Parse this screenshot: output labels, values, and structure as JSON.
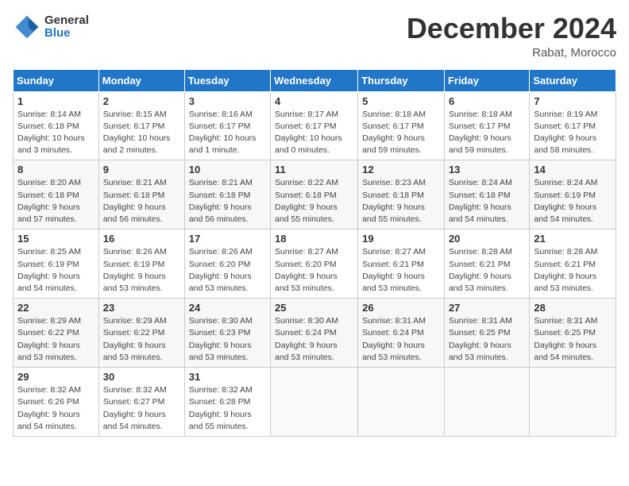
{
  "logo": {
    "general": "General",
    "blue": "Blue"
  },
  "title": "December 2024",
  "location": "Rabat, Morocco",
  "days_of_week": [
    "Sunday",
    "Monday",
    "Tuesday",
    "Wednesday",
    "Thursday",
    "Friday",
    "Saturday"
  ],
  "weeks": [
    [
      {
        "day": "1",
        "sunrise": "8:14 AM",
        "sunset": "6:18 PM",
        "daylight": "10 hours and 3 minutes."
      },
      {
        "day": "2",
        "sunrise": "8:15 AM",
        "sunset": "6:17 PM",
        "daylight": "10 hours and 2 minutes."
      },
      {
        "day": "3",
        "sunrise": "8:16 AM",
        "sunset": "6:17 PM",
        "daylight": "10 hours and 1 minute."
      },
      {
        "day": "4",
        "sunrise": "8:17 AM",
        "sunset": "6:17 PM",
        "daylight": "10 hours and 0 minutes."
      },
      {
        "day": "5",
        "sunrise": "8:18 AM",
        "sunset": "6:17 PM",
        "daylight": "9 hours and 59 minutes."
      },
      {
        "day": "6",
        "sunrise": "8:18 AM",
        "sunset": "6:17 PM",
        "daylight": "9 hours and 59 minutes."
      },
      {
        "day": "7",
        "sunrise": "8:19 AM",
        "sunset": "6:17 PM",
        "daylight": "9 hours and 58 minutes."
      }
    ],
    [
      {
        "day": "8",
        "sunrise": "8:20 AM",
        "sunset": "6:18 PM",
        "daylight": "9 hours and 57 minutes."
      },
      {
        "day": "9",
        "sunrise": "8:21 AM",
        "sunset": "6:18 PM",
        "daylight": "9 hours and 56 minutes."
      },
      {
        "day": "10",
        "sunrise": "8:21 AM",
        "sunset": "6:18 PM",
        "daylight": "9 hours and 56 minutes."
      },
      {
        "day": "11",
        "sunrise": "8:22 AM",
        "sunset": "6:18 PM",
        "daylight": "9 hours and 55 minutes."
      },
      {
        "day": "12",
        "sunrise": "8:23 AM",
        "sunset": "6:18 PM",
        "daylight": "9 hours and 55 minutes."
      },
      {
        "day": "13",
        "sunrise": "8:24 AM",
        "sunset": "6:18 PM",
        "daylight": "9 hours and 54 minutes."
      },
      {
        "day": "14",
        "sunrise": "8:24 AM",
        "sunset": "6:19 PM",
        "daylight": "9 hours and 54 minutes."
      }
    ],
    [
      {
        "day": "15",
        "sunrise": "8:25 AM",
        "sunset": "6:19 PM",
        "daylight": "9 hours and 54 minutes."
      },
      {
        "day": "16",
        "sunrise": "8:26 AM",
        "sunset": "6:19 PM",
        "daylight": "9 hours and 53 minutes."
      },
      {
        "day": "17",
        "sunrise": "8:26 AM",
        "sunset": "6:20 PM",
        "daylight": "9 hours and 53 minutes."
      },
      {
        "day": "18",
        "sunrise": "8:27 AM",
        "sunset": "6:20 PM",
        "daylight": "9 hours and 53 minutes."
      },
      {
        "day": "19",
        "sunrise": "8:27 AM",
        "sunset": "6:21 PM",
        "daylight": "9 hours and 53 minutes."
      },
      {
        "day": "20",
        "sunrise": "8:28 AM",
        "sunset": "6:21 PM",
        "daylight": "9 hours and 53 minutes."
      },
      {
        "day": "21",
        "sunrise": "8:28 AM",
        "sunset": "6:21 PM",
        "daylight": "9 hours and 53 minutes."
      }
    ],
    [
      {
        "day": "22",
        "sunrise": "8:29 AM",
        "sunset": "6:22 PM",
        "daylight": "9 hours and 53 minutes."
      },
      {
        "day": "23",
        "sunrise": "8:29 AM",
        "sunset": "6:22 PM",
        "daylight": "9 hours and 53 minutes."
      },
      {
        "day": "24",
        "sunrise": "8:30 AM",
        "sunset": "6:23 PM",
        "daylight": "9 hours and 53 minutes."
      },
      {
        "day": "25",
        "sunrise": "8:30 AM",
        "sunset": "6:24 PM",
        "daylight": "9 hours and 53 minutes."
      },
      {
        "day": "26",
        "sunrise": "8:31 AM",
        "sunset": "6:24 PM",
        "daylight": "9 hours and 53 minutes."
      },
      {
        "day": "27",
        "sunrise": "8:31 AM",
        "sunset": "6:25 PM",
        "daylight": "9 hours and 53 minutes."
      },
      {
        "day": "28",
        "sunrise": "8:31 AM",
        "sunset": "6:25 PM",
        "daylight": "9 hours and 54 minutes."
      }
    ],
    [
      {
        "day": "29",
        "sunrise": "8:32 AM",
        "sunset": "6:26 PM",
        "daylight": "9 hours and 54 minutes."
      },
      {
        "day": "30",
        "sunrise": "8:32 AM",
        "sunset": "6:27 PM",
        "daylight": "9 hours and 54 minutes."
      },
      {
        "day": "31",
        "sunrise": "8:32 AM",
        "sunset": "6:28 PM",
        "daylight": "9 hours and 55 minutes."
      },
      null,
      null,
      null,
      null
    ]
  ]
}
